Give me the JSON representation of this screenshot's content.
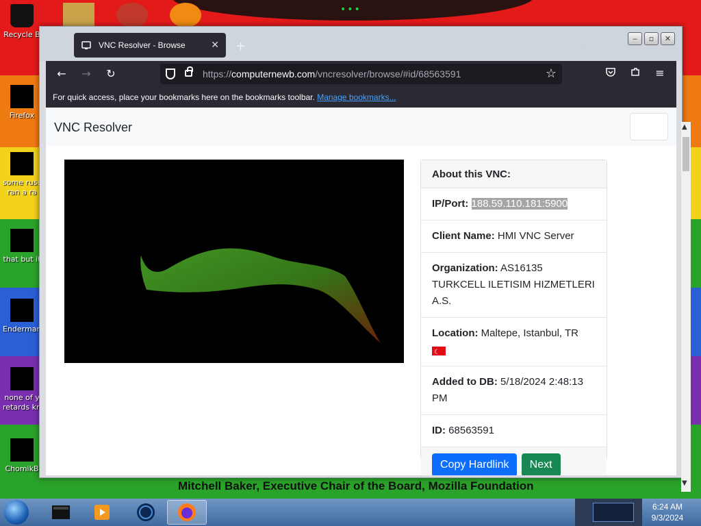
{
  "desktop": {
    "icons": [
      {
        "label": "Recycle B"
      },
      {
        "label": "Firefox"
      },
      {
        "label": "some russ"
      },
      {
        "label": "ran a ra"
      },
      {
        "label": "that but it"
      },
      {
        "label": "Enderman"
      },
      {
        "label": "none of y"
      },
      {
        "label": "retards kn"
      },
      {
        "label": "ChomikB"
      }
    ],
    "background_caption": "Mitchell Baker, Executive Chair of the Board, Mozilla Foundation"
  },
  "browser": {
    "tab_title": "VNC Resolver - Browse",
    "new_tab_glyph": "+",
    "url_host": "computernewb.com",
    "url_prefix": "https://",
    "url_path": "/vncresolver/browse/#id/68563591",
    "bookmarks_text": "For quick access, place your bookmarks here on the bookmarks toolbar.",
    "bookmarks_link": "Manage bookmarks..."
  },
  "page": {
    "site_title": "VNC Resolver",
    "card": {
      "header": "About this VNC:",
      "ip_label": "IP/Port:",
      "ip_value": "188.59.110.181:5900",
      "client_label": "Client Name:",
      "client_value": "HMI VNC Server",
      "org_label": "Organization:",
      "org_value": "AS16135 TURKCELL ILETISIM HIZMETLERI A.S.",
      "location_label": "Location:",
      "location_value": "Maltepe, Istanbul, TR",
      "added_label": "Added to DB:",
      "added_value": "5/18/2024 2:48:13 PM",
      "id_label": "ID:",
      "id_value": "68563591",
      "copy_button": "Copy Hardlink",
      "next_button": "Next"
    }
  },
  "taskbar": {
    "time": "6:24 AM",
    "date": "9/3/2024"
  }
}
